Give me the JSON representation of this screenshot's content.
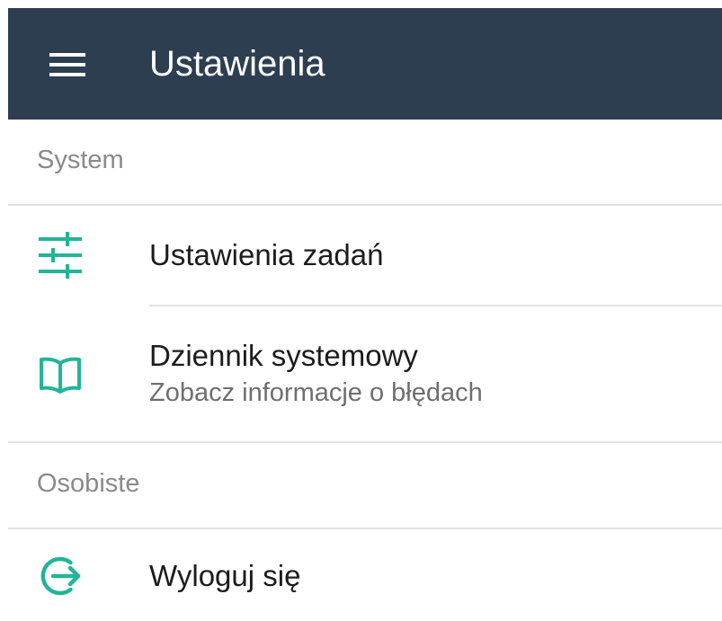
{
  "app_bar": {
    "title": "Ustawienia",
    "background": "#2e3e51",
    "menu_icon": "hamburger-menu-icon"
  },
  "accent_color": "#22b597",
  "sections": [
    {
      "header": "System",
      "items": [
        {
          "title": "Ustawienia zadań",
          "icon": "sliders-icon"
        },
        {
          "title": "Dziennik systemowy",
          "subtitle": "Zobacz informacje o błędach",
          "icon": "book-open-icon"
        }
      ]
    },
    {
      "header": "Osobiste",
      "items": [
        {
          "title": "Wyloguj się",
          "icon": "logout-icon"
        }
      ]
    }
  ]
}
